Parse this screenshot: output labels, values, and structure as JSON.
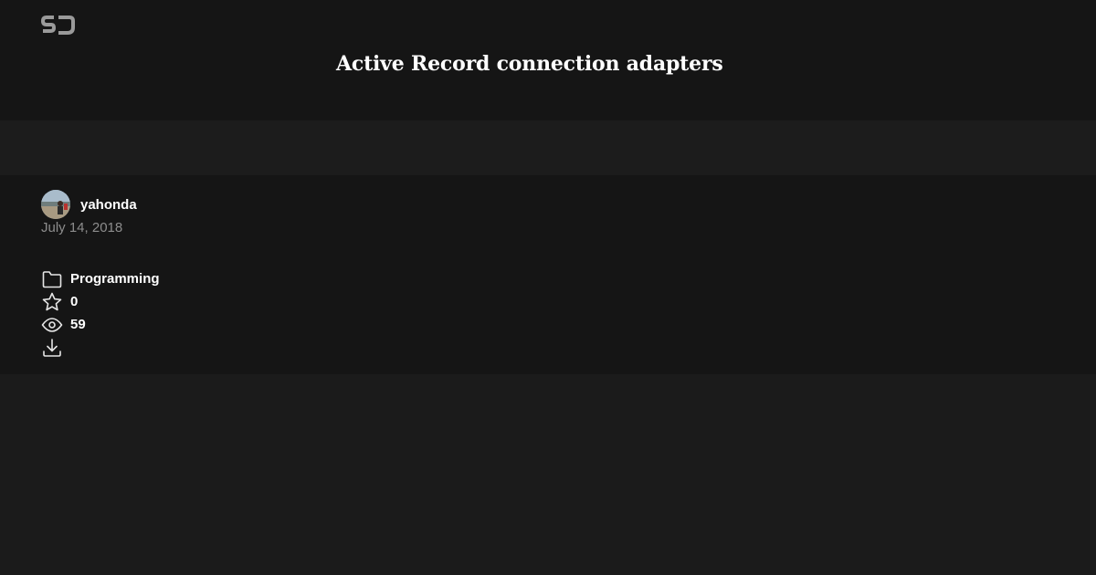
{
  "header": {
    "logo_icon": "sj-logo-icon",
    "title": "Active Record connection adapters"
  },
  "author": {
    "name": "yahonda",
    "avatar_icon": "avatar"
  },
  "date": "July 14, 2018",
  "stats": {
    "category": "Programming",
    "stars": "0",
    "views": "59"
  },
  "colors": {
    "header_bg": "#151515",
    "band_bg": "#1c1c1c",
    "page_bg": "#1b1b1b",
    "logo": "#9a9a9a",
    "muted_text": "#8d8d8d"
  }
}
